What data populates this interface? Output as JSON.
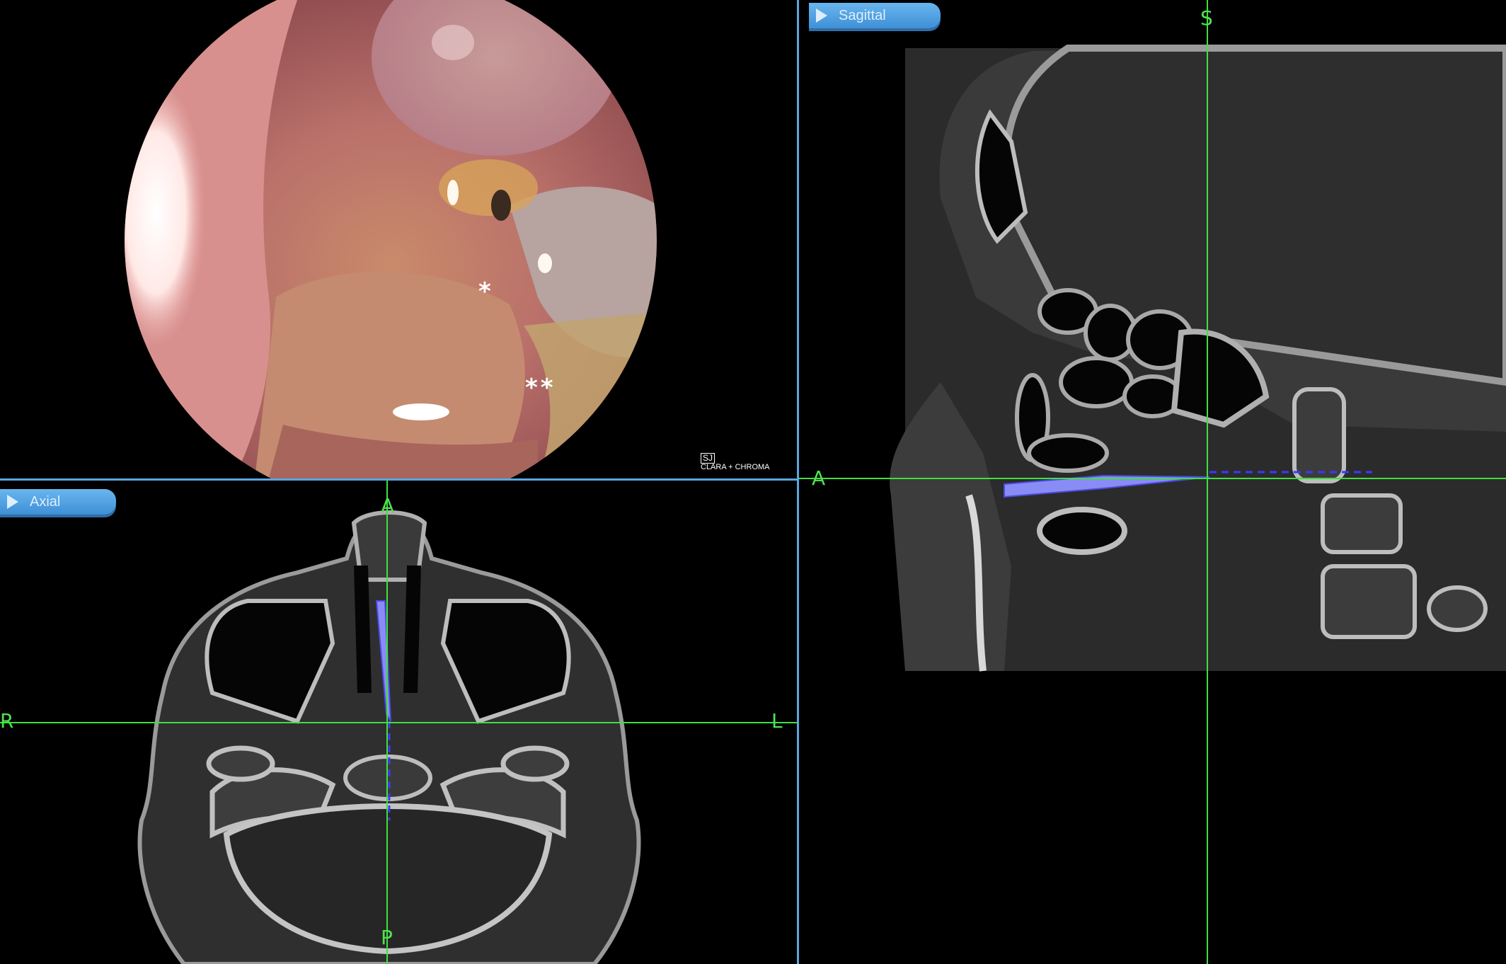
{
  "endoscope": {
    "asterisk_single": "*",
    "asterisk_double": "**",
    "logo_box": "SJ",
    "logo_text": "CLARA + CHROMA"
  },
  "sagittal": {
    "tab_label": "Sagittal",
    "orient_top": "S",
    "orient_left": "A"
  },
  "axial": {
    "tab_label": "Axial",
    "orient_top": "A",
    "orient_left": "R",
    "orient_right": "L",
    "orient_bottom": "P"
  },
  "colors": {
    "crosshair": "#3fe03f",
    "divider": "#5aa6e0",
    "tab": "#4a9ee0",
    "probe": "#7a7cf0"
  },
  "icons": {
    "play": "play-icon"
  }
}
